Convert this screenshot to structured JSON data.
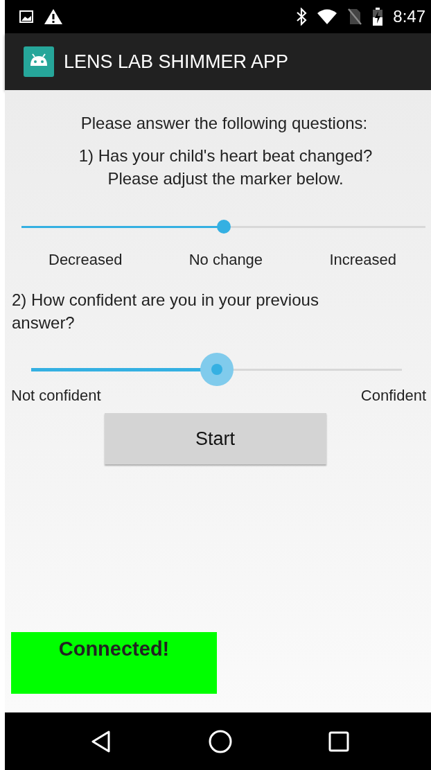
{
  "status_bar": {
    "time": "8:47"
  },
  "app_bar": {
    "title": "LENS LAB SHIMMER APP"
  },
  "intro": "Please answer the following questions:",
  "questions": [
    {
      "text": "1) Has your child's heart beat changed?\nPlease adjust the marker below.",
      "kind": "centered",
      "slider": {
        "level": 0.5,
        "focused": false
      },
      "labels": [
        "Decreased",
        "No change",
        "Increased"
      ]
    },
    {
      "text": "2) How confident are you in your previous answer?",
      "kind": "left",
      "slider": {
        "level": 0.5,
        "focused": true
      },
      "labels": [
        "Not confident",
        "Confident"
      ]
    }
  ],
  "start_button": "Start",
  "status": {
    "text": "Connected!",
    "color": "#00ff00"
  }
}
